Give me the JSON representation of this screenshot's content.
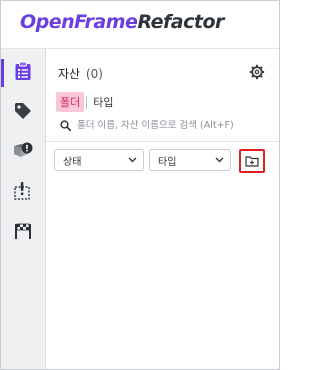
{
  "app": {
    "brand": "OpenFrame",
    "product": "Refactor"
  },
  "rail": {
    "items": [
      {
        "icon": "clipboard-list-icon",
        "active": true
      },
      {
        "icon": "tag-icon",
        "active": false
      },
      {
        "icon": "alert-package-icon",
        "active": false
      },
      {
        "icon": "dashed-alert-icon",
        "active": false
      },
      {
        "icon": "checkered-flag-icon",
        "active": false
      }
    ]
  },
  "panel": {
    "title": "자산",
    "count": "(0)"
  },
  "tabs": [
    {
      "label": "폴더",
      "active": true
    },
    {
      "label": "타입",
      "active": false
    }
  ],
  "search": {
    "placeholder": "폴더 이름, 자산 이름으로 검색 (Alt+F)",
    "value": ""
  },
  "filters": {
    "status_label": "상태",
    "type_label": "타입"
  },
  "colors": {
    "accent": "#6a3ee0",
    "tab_active_bg": "#f9c7d6",
    "tab_active_text": "#d2246b",
    "highlight": "#e02020"
  }
}
